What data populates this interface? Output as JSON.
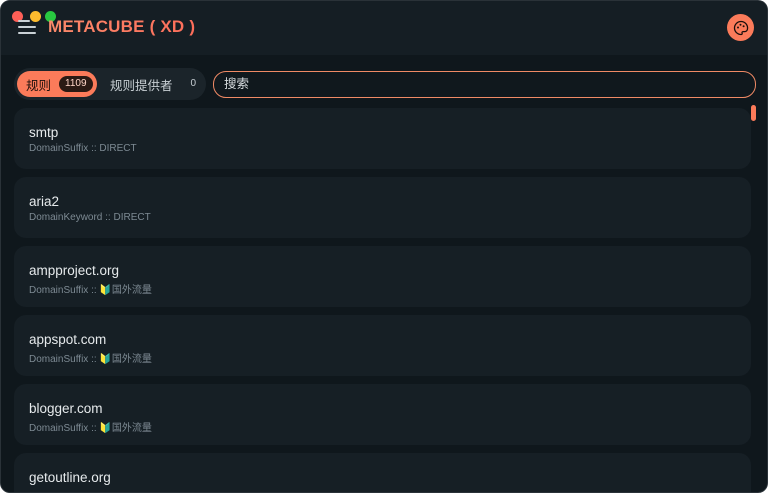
{
  "app": {
    "title": "METACUBE ( XD )"
  },
  "tabs": [
    {
      "label": "规则",
      "count": "1109"
    },
    {
      "label": "规则提供者",
      "count": "0"
    }
  ],
  "search": {
    "placeholder": "搜索"
  },
  "rules": [
    {
      "name": "smtp",
      "detail": "DomainSuffix :: DIRECT"
    },
    {
      "name": "aria2",
      "detail": "DomainKeyword :: DIRECT"
    },
    {
      "name": "ampproject.org",
      "detail": "DomainSuffix :: 🔰国外流量"
    },
    {
      "name": "appspot.com",
      "detail": "DomainSuffix :: 🔰国外流量"
    },
    {
      "name": "blogger.com",
      "detail": "DomainSuffix :: 🔰国外流量"
    },
    {
      "name": "getoutline.org",
      "detail": ""
    }
  ],
  "colors": {
    "accent": "#fb7b5a",
    "background": "#0f171c",
    "card": "#161f25"
  },
  "icons": {
    "menu": "hamburger-menu-icon",
    "theme": "palette-icon"
  }
}
